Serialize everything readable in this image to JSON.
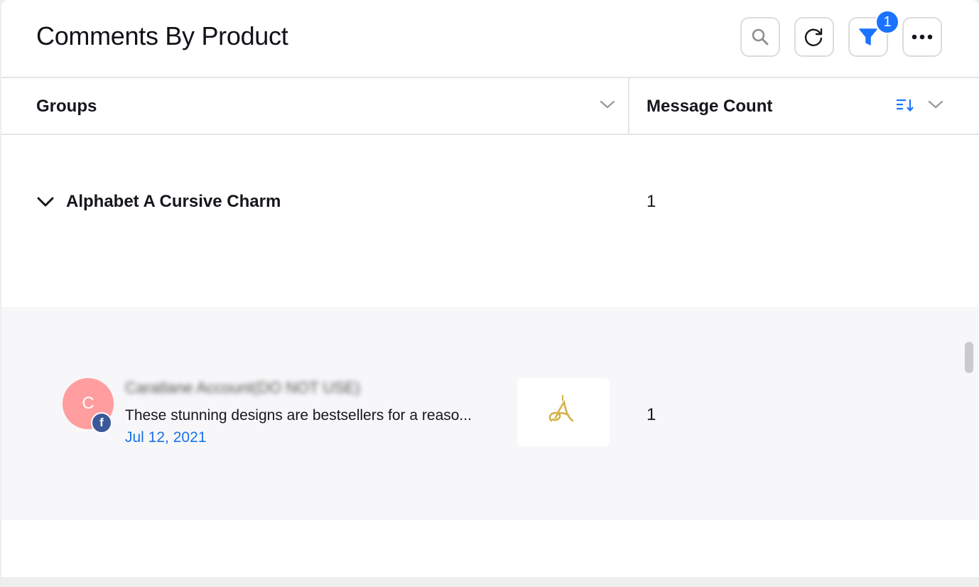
{
  "header": {
    "title": "Comments By Product",
    "toolbar": [
      {
        "name": "search-button",
        "icon": "search-icon"
      },
      {
        "name": "refresh-button",
        "icon": "refresh-icon"
      },
      {
        "name": "filter-button",
        "icon": "filter-icon",
        "badge": "1"
      },
      {
        "name": "more-button",
        "icon": "more-icon"
      }
    ],
    "filter_badge": "1"
  },
  "columns": {
    "groups": "Groups",
    "message_count": "Message Count"
  },
  "group": {
    "name": "Alphabet A Cursive Charm",
    "count": "1",
    "expanded": true
  },
  "message": {
    "avatar_initial": "C",
    "author": "Caratlane Account(DO NOT USE)",
    "channel": "facebook",
    "text": "These stunning designs are bestsellers for a reaso...",
    "date": "Jul 12, 2021",
    "count": "1"
  },
  "colors": {
    "accent": "#1a73ff",
    "avatar": "#ff9d9f",
    "facebook": "#3b5998",
    "date": "#1a73e8"
  }
}
